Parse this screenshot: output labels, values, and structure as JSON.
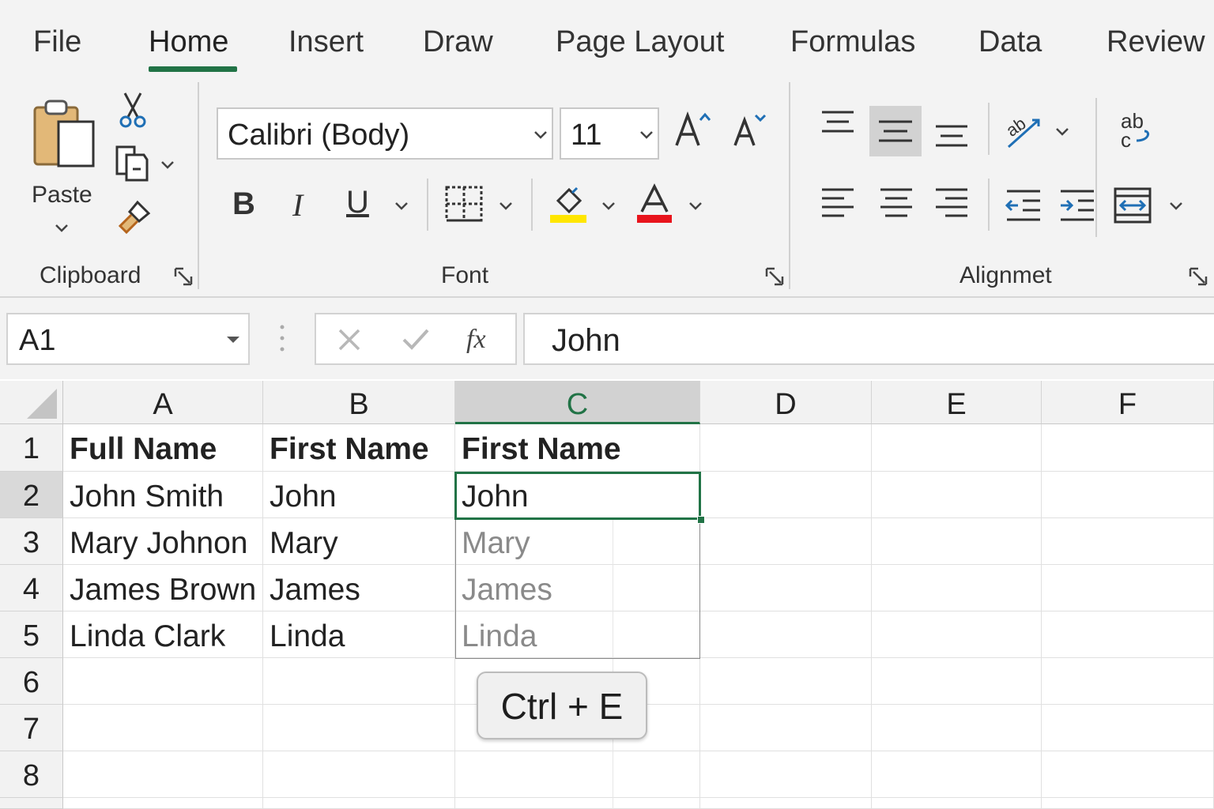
{
  "ribbon": {
    "tabs": [
      {
        "label": "File"
      },
      {
        "label": "Home"
      },
      {
        "label": "Insert"
      },
      {
        "label": "Draw"
      },
      {
        "label": "Page Layout"
      },
      {
        "label": "Formulas"
      },
      {
        "label": "Data"
      },
      {
        "label": "Review"
      }
    ],
    "active_tab": "Home",
    "clipboard": {
      "label": "Clipboard",
      "paste_label": "Paste"
    },
    "font": {
      "label": "Font",
      "font_name": "Calibri (Body)",
      "font_size": "11",
      "bold_glyph": "B",
      "italic_glyph": "I",
      "underline_glyph": "U"
    },
    "alignment": {
      "label": "Alignmet"
    }
  },
  "formula_bar": {
    "name_box": "A1",
    "value": "John"
  },
  "sheet": {
    "columns": [
      "A",
      "B",
      "C",
      "D",
      "E",
      "F"
    ],
    "selected_column": "C",
    "rows": [
      "1",
      "2",
      "3",
      "4",
      "5",
      "6",
      "7",
      "8"
    ],
    "selected_row": "2",
    "cells": {
      "A1": "Full Name",
      "B1": "First Name",
      "C1": "First Name",
      "A2": "John Smith",
      "B2": "John",
      "C2": "John",
      "A3": "Mary Johnon",
      "B3": "Mary",
      "C3": "Mary",
      "A4": "James Brown",
      "B4": "James",
      "C4": "James",
      "A5": "Linda Clark",
      "B5": "Linda",
      "C5": "Linda"
    }
  },
  "shortcut_hint": "Ctrl + E",
  "colors": {
    "accent": "#217346",
    "highlight_bar": "#ffe600",
    "font_color_bar": "#e8141c",
    "ghost_text": "#8a8a8a"
  }
}
